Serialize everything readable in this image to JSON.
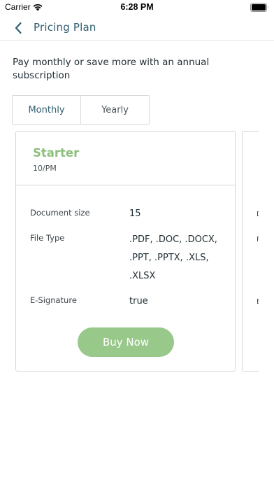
{
  "status_bar": {
    "carrier": "Carrier",
    "time": "6:28 PM",
    "icons": [
      "wifi-icon",
      "battery-icon"
    ]
  },
  "nav": {
    "back_icon": "chevron-left-icon",
    "title": "Pricing Plan"
  },
  "description": "Pay monthly or save more with an annual subscription",
  "billing_toggle": {
    "options": [
      "Monthly",
      "Yearly"
    ],
    "selected": "Monthly"
  },
  "plans": [
    {
      "name": "Starter",
      "price": "10/PM",
      "features": [
        {
          "label": "Document size",
          "value": "15"
        },
        {
          "label": "File Type",
          "value": ".PDF, .DOC, .DOCX, .PPT, .PPTX, .XLS, .XLSX"
        },
        {
          "label": "E-Signature",
          "value": "true"
        }
      ],
      "cta": "Buy Now"
    }
  ],
  "next_card_peek": [
    "D",
    "F",
    "E"
  ],
  "colors": {
    "accent": "#2f5d6e",
    "plan_name": "#8dbf7d",
    "buy_button": "#98c88a",
    "border": "#d3d7d9"
  }
}
